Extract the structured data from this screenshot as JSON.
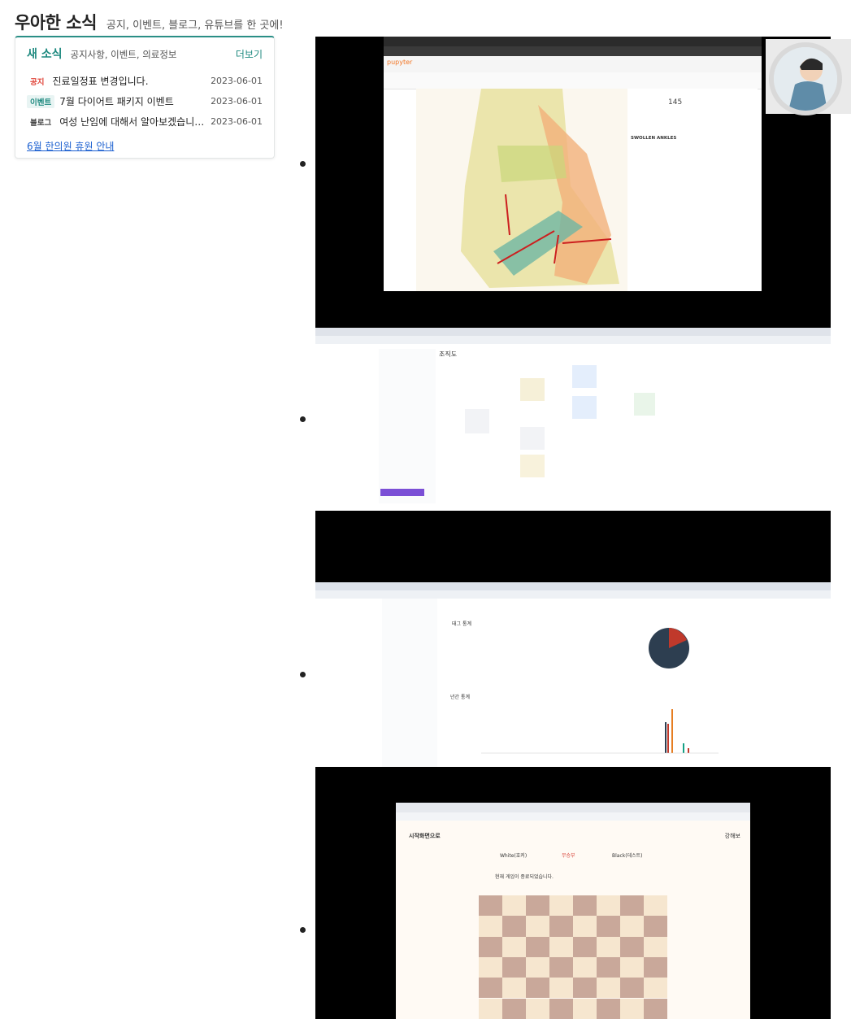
{
  "header": {
    "title": "우아한 소식",
    "subtitle": "공지, 이벤트, 블로그, 유튜브를 한 곳에!"
  },
  "news": {
    "heading": "새 소식",
    "categories": "공지사항, 이벤트, 의료정보",
    "more_label": "더보기",
    "items": [
      {
        "badge": "공지",
        "title": "진료일정표 변경입니다.",
        "date": "2023-06-01"
      },
      {
        "badge": "이벤트",
        "title": "7월 다이어트 패키지 이벤트",
        "date": "2023-06-01"
      },
      {
        "badge": "블로그",
        "title": "여성 난임에 대해서 알아보겠습니다ddd",
        "date": "2023-06-01"
      }
    ],
    "holiday_link": "6월 한의원 휴원 안내"
  },
  "shots": {
    "s1": {
      "app": "pupyter",
      "note_title": "SWOLLEN ANKLES",
      "counter": "145"
    },
    "s2": {
      "heading": "조직도"
    },
    "s3": {
      "tag_stats": "태그 통계",
      "yearly_stats": "년간 통계"
    },
    "s4": {
      "back": "시작화면으로",
      "leave": "강해보",
      "white": "White(호커)",
      "black": "Black(데스트)",
      "vs": "무승부",
      "message": "현재 게임이 종료되었습니다."
    }
  },
  "colors": {
    "accent": "#1f8a80",
    "notice": "#e0453a",
    "link": "#1a5fd0"
  }
}
